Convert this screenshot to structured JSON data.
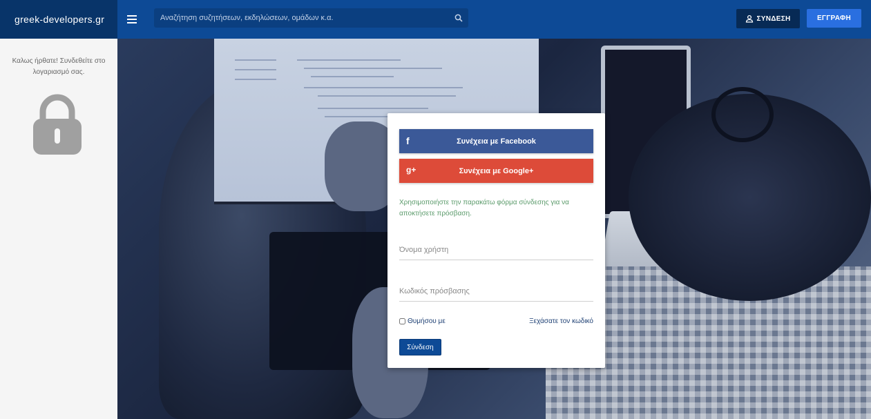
{
  "header": {
    "brand": "greek-developers.gr",
    "search_placeholder": "Αναζήτηση συζητήσεων, εκδηλώσεων, ομάδων κ.α.",
    "login_label": "ΣΥΝΔΕΣΗ",
    "register_label": "ΕΓΓΡΑΦΗ"
  },
  "sidebar": {
    "welcome_text": "Καλως ήρθατε! Συνδεθείτε στο λογαριασμό σας."
  },
  "login_card": {
    "facebook_label": "Συνέχεια με Facebook",
    "facebook_icon": "f",
    "google_label": "Συνέχεια με Google+",
    "google_icon": "g+",
    "hint": "Χρησιμοποιήστε την παρακάτω φόρμα σύνδεσης για να αποκτήσετε πρόσβαση.",
    "username_placeholder": "Όνομα χρήστη",
    "password_placeholder": "Κωδικός πρόσβασης",
    "remember_label": "Θυμήσου με",
    "forgot_label": "Ξεχάσατε τον κωδικό",
    "submit_label": "Σύνδεση"
  },
  "colors": {
    "topbar": "#0d4a96",
    "brand_bg": "#083469",
    "facebook": "#3b5998",
    "google": "#dd4b39",
    "register": "#2a6fe0",
    "hint": "#5a9a6a"
  }
}
